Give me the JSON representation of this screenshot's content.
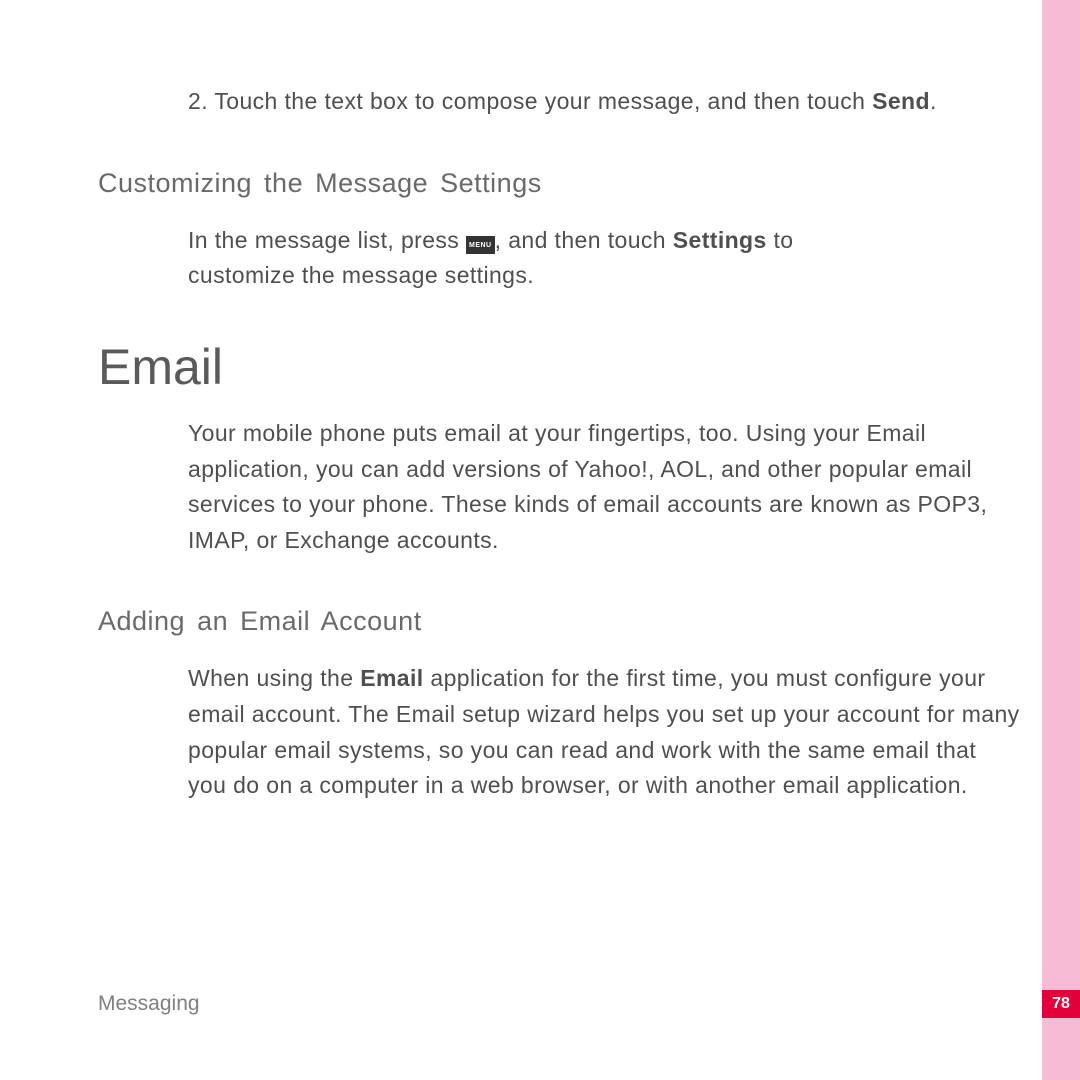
{
  "step": {
    "prefix": "2. Touch the text box to compose your message, and then touch ",
    "bold": "Send",
    "suffix": "."
  },
  "customizing": {
    "heading": "Customizing the Message Settings",
    "line1_before": "In the message list, press ",
    "menu_label": "MENU",
    "line1_after_before_bold": ", and then touch ",
    "line1_bold": "Settings",
    "line1_after_bold": " to",
    "line2": "customize the message settings."
  },
  "email": {
    "title": "Email",
    "intro": "Your mobile phone puts email at your fingertips, too. Using your Email application, you can add versions of Yahoo!, AOL, and other popular email services to your phone. These kinds of email accounts are known as POP3, IMAP, or Exchange accounts."
  },
  "adding": {
    "heading": "Adding an Email Account",
    "body_before": "When using the ",
    "body_bold": "Email",
    "body_after": " application for the first time, you must configure your email account. The Email setup wizard helps you set up your account for many popular email systems, so you can read and work with the same email that you do on a computer in a web browser, or with another email application."
  },
  "footer": "Messaging",
  "page_number": "78"
}
